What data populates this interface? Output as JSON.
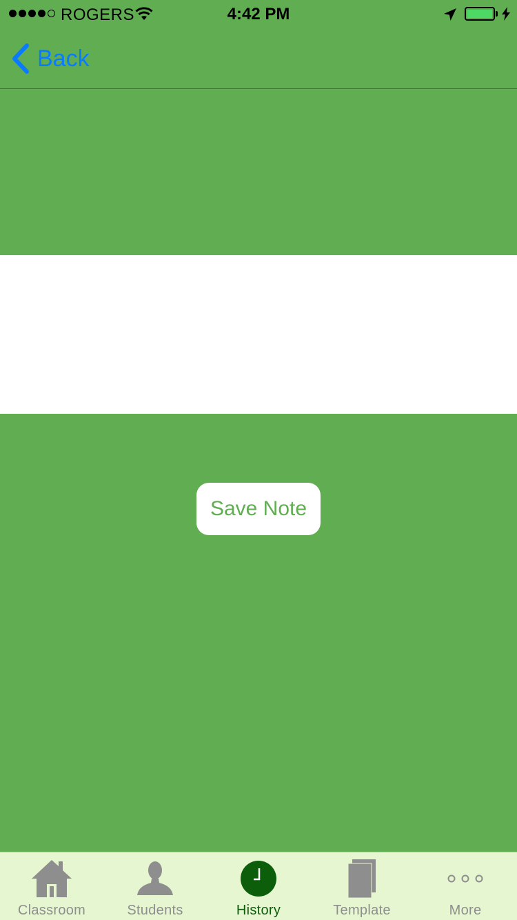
{
  "status_bar": {
    "carrier": "ROGERS",
    "time": "4:42 PM",
    "signal_bars_filled": 4,
    "signal_bars_total": 5,
    "battery_color": "#4CD964"
  },
  "nav": {
    "back_label": "Back",
    "back_icon": "chevron-left-icon",
    "accent_color": "#0A7AFF"
  },
  "main": {
    "background_color": "#61AE52",
    "save_button_label": "Save Note"
  },
  "tab_bar": {
    "active_tab": "History",
    "active_color": "#0C5E0B",
    "inactive_color": "#8E8E8E",
    "tabs": [
      {
        "label": "Classroom",
        "icon": "house-icon"
      },
      {
        "label": "Students",
        "icon": "person-icon"
      },
      {
        "label": "History",
        "icon": "clock-icon"
      },
      {
        "label": "Template",
        "icon": "documents-icon"
      },
      {
        "label": "More",
        "icon": "more-dots-icon"
      }
    ]
  }
}
